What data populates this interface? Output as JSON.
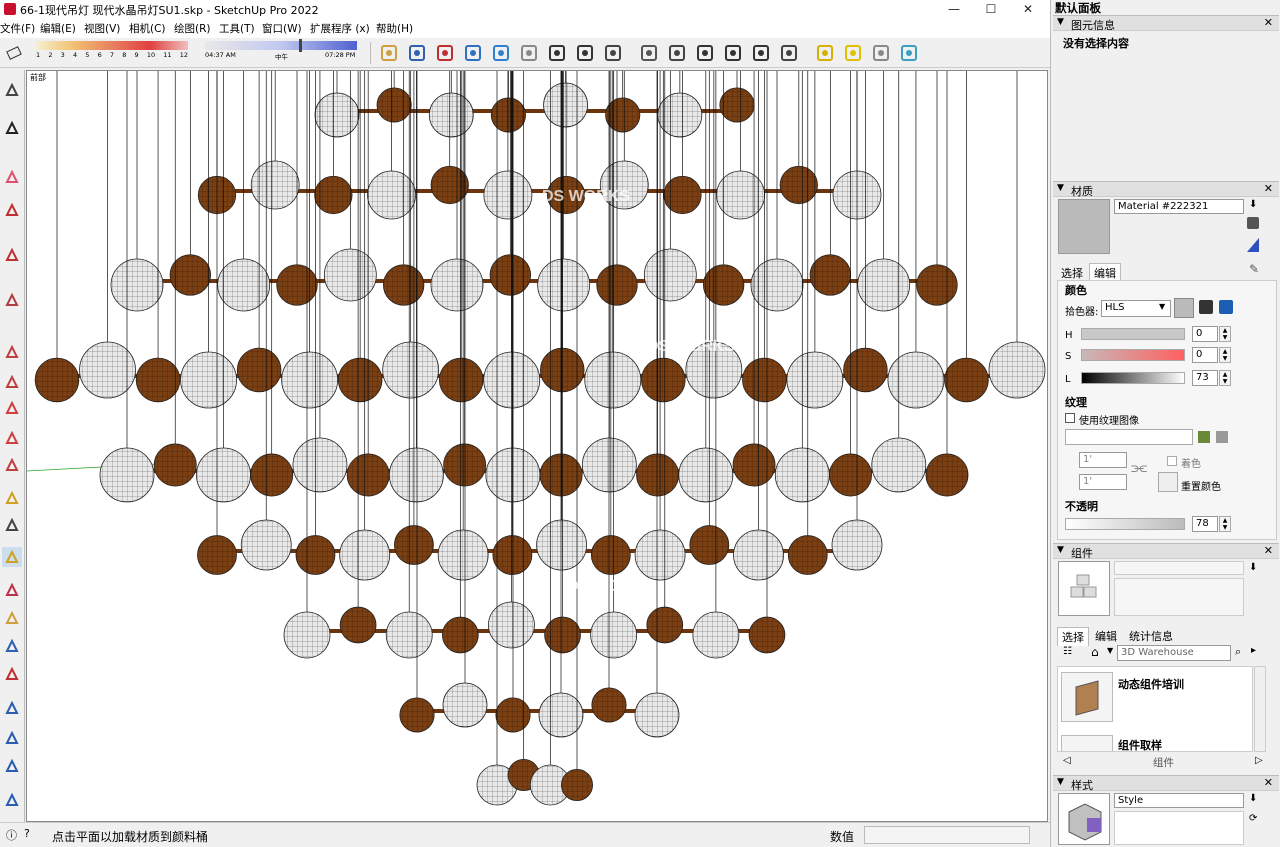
{
  "window": {
    "title": "66-1现代吊灯 现代水晶吊灯SU1.skp - SketchUp Pro 2022",
    "minimize": "—",
    "maximize": "☐",
    "close": "✕"
  },
  "menu": [
    "文件(F)",
    "编辑(E)",
    "视图(V)",
    "相机(C)",
    "绘图(R)",
    "工具(T)",
    "窗口(W)",
    "扩展程序 (x)",
    "帮助(H)"
  ],
  "shadows": {
    "ticks": [
      "1",
      "2",
      "3",
      "4",
      "5",
      "6",
      "7",
      "8",
      "9",
      "10",
      "11",
      "12"
    ],
    "time_start": "04:37 AM",
    "time_mid": "中午",
    "time_end": "07:28 PM",
    "time_position": 0.62
  },
  "toolbar_icons": [
    "paint-bucket-icon",
    "orbit-icon",
    "pan-icon",
    "zoom-icon",
    "zoom-window-icon",
    "zoom-extents-icon",
    "previous-view-icon",
    "position-camera-icon",
    "look-around-icon",
    "walk-icon",
    "iso-view-icon",
    "top-view-icon",
    "front-view-icon",
    "right-view-icon",
    "back-view-icon",
    "left-view-icon",
    "xray-icon",
    "wireframe-icon",
    "shaded-icon",
    "shaded-textures-icon"
  ],
  "viewport": {
    "scene_label": "前部",
    "watermark": "DS WORKS"
  },
  "status": {
    "text": "点击平面以加载材质到颜料桶",
    "measure_label": "数值",
    "measure_value": ""
  },
  "tray": {
    "title": "默认面板",
    "entity_info": {
      "header": "图元信息",
      "content": "没有选择内容"
    },
    "materials": {
      "header": "材质",
      "name": "Material #222321",
      "tabs": [
        "选择",
        "编辑"
      ],
      "color_label": "颜色",
      "picker_label": "拾色器:",
      "picker_value": "HLS",
      "h_label": "H",
      "h_value": "0",
      "s_label": "S",
      "s_value": "0",
      "l_label": "L",
      "l_value": "73",
      "texture_label": "纹理",
      "use_texture": "使用纹理图像",
      "size_w": "1'",
      "size_h": "1'",
      "colorize": "着色",
      "reset_color": "重置颜色",
      "opacity_label": "不透明",
      "opacity_value": "78",
      "swatch_color": "#bababa"
    },
    "components": {
      "header": "组件",
      "tabs": [
        "选择",
        "编辑",
        "统计信息"
      ],
      "search_placeholder": "3D Warehouse",
      "items": [
        "动态组件培训",
        "组件取样"
      ],
      "footer": "组件"
    },
    "styles": {
      "header": "样式",
      "name": "Style"
    }
  },
  "colors": {
    "sphere_light": "#e8e8e8",
    "sphere_dark": "#7a3f12",
    "accent_blue": "#2a5db0"
  }
}
